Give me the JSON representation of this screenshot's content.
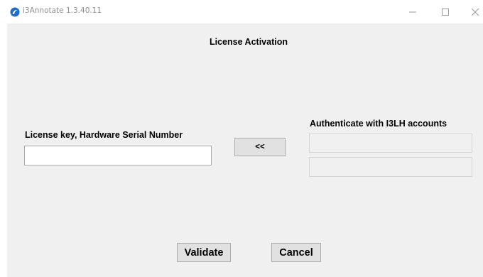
{
  "window": {
    "title": "i3Annotate 1.3.40.11",
    "app_icon": "i3annotate-logo-icon",
    "controls": [
      "minimize-icon",
      "maximize-icon",
      "close-icon"
    ]
  },
  "dialog": {
    "heading": "License Activation",
    "license_label": "License key, Hardware Serial Number",
    "license_value": "",
    "auth_label": "Authenticate with I3LH accounts",
    "auth_username_value": "",
    "auth_password_value": "",
    "transfer_button_label": "<<",
    "validate_button_label": "Validate",
    "cancel_button_label": "Cancel"
  },
  "colors": {
    "dialog_background": "#f0f0f0",
    "button_face": "#e1e1e1",
    "title_text": "#909090",
    "app_icon_blue": "#1e6fc4"
  }
}
